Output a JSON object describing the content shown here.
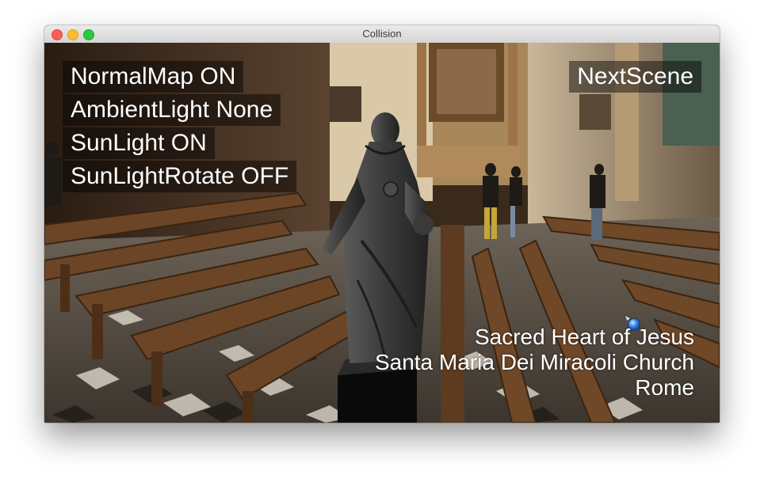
{
  "window": {
    "title": "Collision"
  },
  "menu": {
    "items": [
      {
        "label": "NormalMap ON"
      },
      {
        "label": "AmbientLight None"
      },
      {
        "label": "SunLight ON"
      },
      {
        "label": "SunLightRotate OFF"
      }
    ]
  },
  "next_scene": {
    "label": "NextScene"
  },
  "caption": {
    "line1": "Sacred Heart of Jesus",
    "line2": "Santa Maria Dei Miracoli Church",
    "line3": "Rome"
  },
  "icons": {
    "pointer": "blue-orb-cursor-icon"
  },
  "colors": {
    "overlay_bg": "#000000",
    "text": "#ffffff",
    "close": "#fd5e57",
    "minimize": "#fdbb2e",
    "maximize": "#2ac840"
  }
}
